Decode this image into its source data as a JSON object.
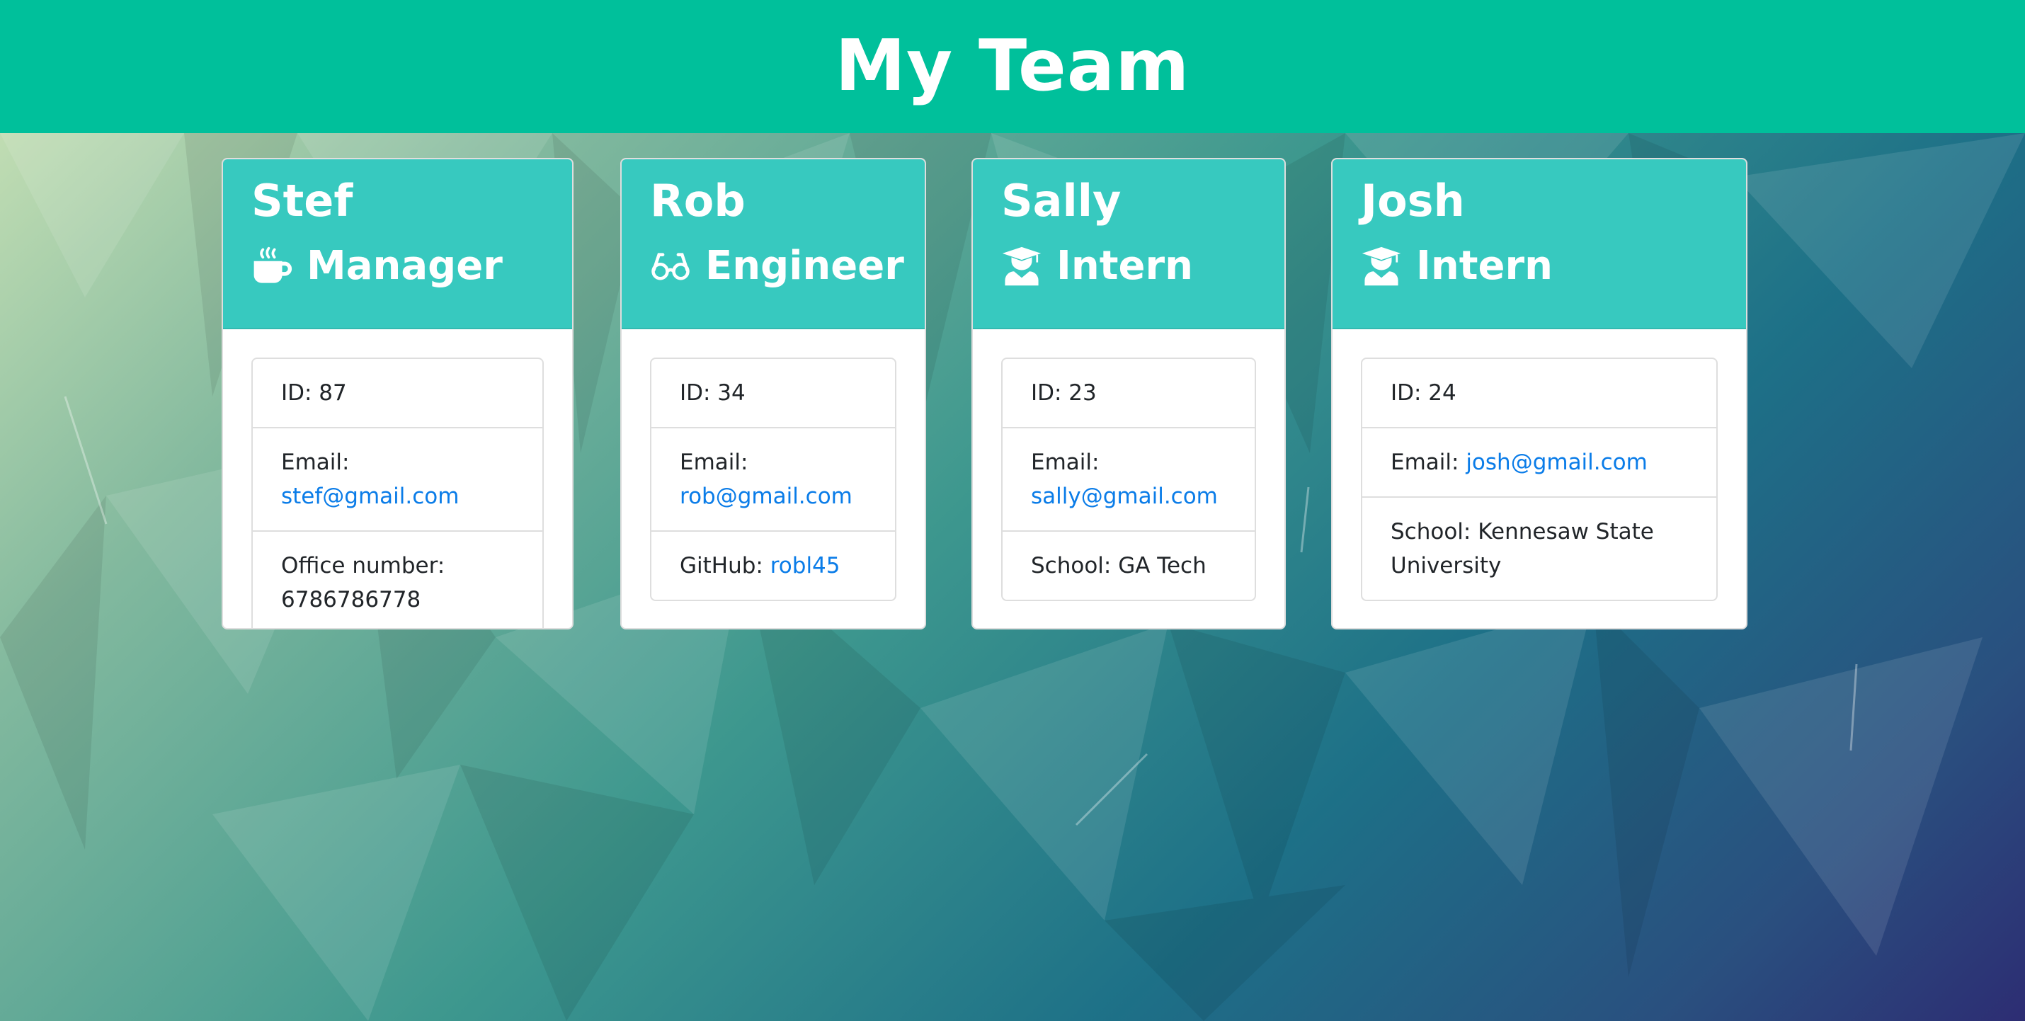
{
  "header": {
    "title": "My Team"
  },
  "colors": {
    "header_bg": "#00c09b",
    "card_head_bg": "#37c9bf",
    "link": "#0a7ce8"
  },
  "employees": [
    {
      "name": "Stef",
      "role": "Manager",
      "role_icon": "coffee-mug-icon",
      "id_text": "ID: 87",
      "email_label": "Email:",
      "email": "stef@gmail.com",
      "extra_label": "Office number:",
      "extra_value": "6786786778"
    },
    {
      "name": "Rob",
      "role": "Engineer",
      "role_icon": "glasses-icon",
      "id_text": "ID: 34",
      "email_label": "Email:",
      "email": "rob@gmail.com",
      "extra_label": "GitHub:",
      "extra_value": "robl45"
    },
    {
      "name": "Sally",
      "role": "Intern",
      "role_icon": "graduate-icon",
      "id_text": "ID: 23",
      "email_label": "Email:",
      "email": "sally@gmail.com",
      "extra_label": "School:",
      "extra_value": "GA Tech"
    },
    {
      "name": "Josh",
      "role": "Intern",
      "role_icon": "graduate-icon",
      "id_text": "ID: 24",
      "email_label": "Email:",
      "email": "josh@gmail.com",
      "extra_label": "School:",
      "extra_value": "Kennesaw State University"
    }
  ]
}
